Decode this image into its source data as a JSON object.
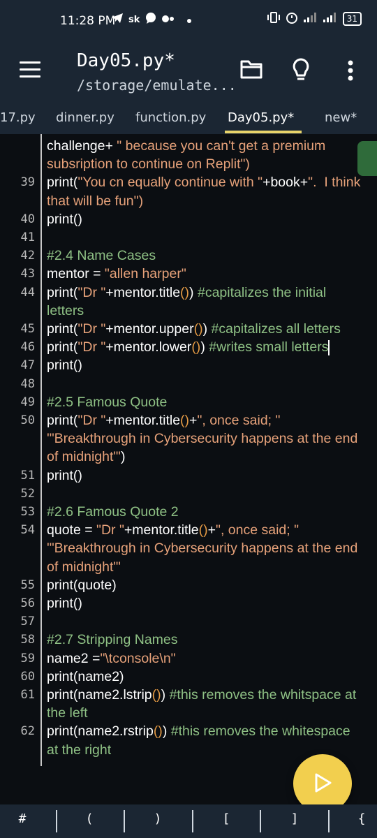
{
  "status_bar": {
    "time": "11:28 PM",
    "carrier": "sk",
    "battery": "31"
  },
  "app_bar": {
    "title": "Day05.py*",
    "subtitle": "/storage/emulate..."
  },
  "tabs": [
    {
      "label": "17.py",
      "active": false
    },
    {
      "label": "dinner.py",
      "active": false
    },
    {
      "label": "function.py",
      "active": false
    },
    {
      "label": "Day05.py*",
      "active": true
    },
    {
      "label": "new*",
      "active": false
    }
  ],
  "code_lines": [
    {
      "num": "",
      "segs": [
        [
          "plain",
          "challenge+"
        ],
        [
          "str",
          " \" because you can't get a premium"
        ]
      ]
    },
    {
      "num": "",
      "segs": [
        [
          "str",
          "subsription to continue on Replit\")"
        ]
      ]
    },
    {
      "num": "39",
      "segs": [
        [
          "plain",
          "print("
        ],
        [
          "str",
          "\"You cn equally continue with \""
        ],
        [
          "plain",
          "+book+"
        ],
        [
          "str",
          "\".  I think"
        ]
      ]
    },
    {
      "num": "",
      "segs": [
        [
          "str",
          "that will be fun\")"
        ]
      ]
    },
    {
      "num": "40",
      "segs": [
        [
          "plain",
          "print()"
        ]
      ]
    },
    {
      "num": "41",
      "segs": []
    },
    {
      "num": "42",
      "segs": [
        [
          "cmt",
          "#2.4 Name Cases"
        ]
      ]
    },
    {
      "num": "43",
      "segs": [
        [
          "plain",
          "mentor = "
        ],
        [
          "str",
          "\"allen harper\""
        ]
      ]
    },
    {
      "num": "44",
      "segs": [
        [
          "plain",
          "print("
        ],
        [
          "str",
          "\"Dr \""
        ],
        [
          "plain",
          "+mentor.title"
        ],
        [
          "paren",
          "()"
        ],
        [
          "plain",
          ") "
        ],
        [
          "cmt",
          "#capitalizes the initial"
        ]
      ]
    },
    {
      "num": "",
      "segs": [
        [
          "cmt",
          "letters"
        ]
      ]
    },
    {
      "num": "45",
      "segs": [
        [
          "plain",
          "print("
        ],
        [
          "str",
          "\"Dr \""
        ],
        [
          "plain",
          "+mentor.upper"
        ],
        [
          "paren",
          "()"
        ],
        [
          "plain",
          ") "
        ],
        [
          "cmt",
          "#capitalizes all letters"
        ]
      ]
    },
    {
      "num": "46",
      "segs": [
        [
          "plain",
          "print("
        ],
        [
          "str",
          "\"Dr \""
        ],
        [
          "plain",
          "+mentor.lower"
        ],
        [
          "paren",
          "()"
        ],
        [
          "plain",
          ") "
        ],
        [
          "cmt",
          "#writes small letters"
        ]
      ],
      "cursor": true
    },
    {
      "num": "47",
      "segs": [
        [
          "plain",
          "print()"
        ]
      ]
    },
    {
      "num": "48",
      "segs": []
    },
    {
      "num": "49",
      "segs": [
        [
          "cmt",
          "#2.5 Famous Quote"
        ]
      ]
    },
    {
      "num": "50",
      "segs": [
        [
          "plain",
          "print("
        ],
        [
          "str",
          "\"Dr \""
        ],
        [
          "plain",
          "+mentor.title"
        ],
        [
          "paren",
          "()"
        ],
        [
          "plain",
          "+"
        ],
        [
          "str",
          "\", once said; \""
        ]
      ]
    },
    {
      "num": "",
      "segs": [
        [
          "str",
          "'\"Breakthrough in Cybersecurity happens at the end"
        ]
      ]
    },
    {
      "num": "",
      "segs": [
        [
          "str",
          "of midnight\"'"
        ],
        [
          "plain",
          ")"
        ]
      ]
    },
    {
      "num": "51",
      "segs": [
        [
          "plain",
          "print()"
        ]
      ]
    },
    {
      "num": "52",
      "segs": []
    },
    {
      "num": "53",
      "segs": [
        [
          "cmt",
          "#2.6 Famous Quote 2"
        ]
      ]
    },
    {
      "num": "54",
      "segs": [
        [
          "plain",
          "quote = "
        ],
        [
          "str",
          "\"Dr \""
        ],
        [
          "plain",
          "+mentor.title"
        ],
        [
          "paren",
          "()"
        ],
        [
          "plain",
          "+"
        ],
        [
          "str",
          "\", once said; \""
        ]
      ]
    },
    {
      "num": "",
      "segs": [
        [
          "str",
          "'\"Breakthrough in Cybersecurity happens at the end"
        ]
      ]
    },
    {
      "num": "",
      "segs": [
        [
          "str",
          "of midnight\"'"
        ]
      ]
    },
    {
      "num": "55",
      "segs": [
        [
          "plain",
          "print(quote)"
        ]
      ]
    },
    {
      "num": "56",
      "segs": [
        [
          "plain",
          "print()"
        ]
      ]
    },
    {
      "num": "57",
      "segs": []
    },
    {
      "num": "58",
      "segs": [
        [
          "cmt",
          "#2.7 Stripping Names"
        ]
      ]
    },
    {
      "num": "59",
      "segs": [
        [
          "plain",
          "name2 ="
        ],
        [
          "str",
          "\"\\tconsole\\n\""
        ]
      ]
    },
    {
      "num": "60",
      "segs": [
        [
          "plain",
          "print(name2)"
        ]
      ]
    },
    {
      "num": "61",
      "segs": [
        [
          "plain",
          "print(name2.lstrip"
        ],
        [
          "paren",
          "()"
        ],
        [
          "plain",
          ") "
        ],
        [
          "cmt",
          "#this removes the whitspace at"
        ]
      ]
    },
    {
      "num": "",
      "segs": [
        [
          "cmt",
          "the left"
        ]
      ]
    },
    {
      "num": "62",
      "segs": [
        [
          "plain",
          "print(name2.rstrip"
        ],
        [
          "paren",
          "()"
        ],
        [
          "plain",
          ") "
        ],
        [
          "cmt",
          "#this removes the whitespace"
        ]
      ]
    },
    {
      "num": "",
      "segs": [
        [
          "cmt",
          "at the right"
        ]
      ]
    }
  ],
  "bottom_keys": [
    "#",
    "(",
    ")",
    "[",
    "]",
    "{"
  ],
  "colors": {
    "bar": "#1b2633",
    "editor_bg": "#0b0e12",
    "string": "#e7a27a",
    "comment": "#8fc185",
    "accent": "#f2cf4e"
  }
}
